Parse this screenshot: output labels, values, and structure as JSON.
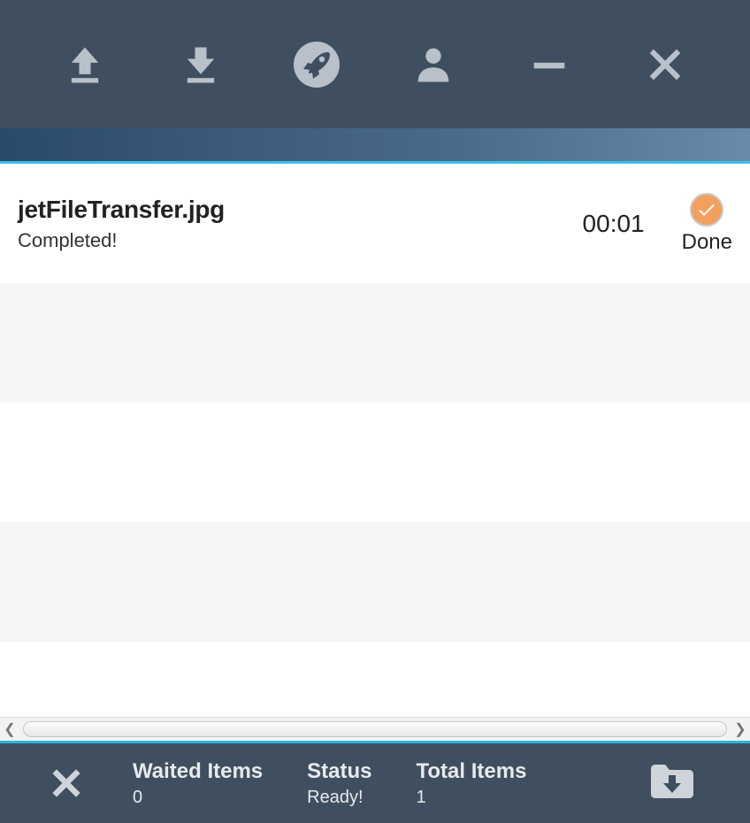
{
  "toolbar": {
    "icons": [
      "upload-icon",
      "download-icon",
      "rocket-icon",
      "user-icon",
      "minimize-icon",
      "close-icon"
    ]
  },
  "transfers": [
    {
      "filename": "jetFileTransfer.jpg",
      "status_text": "Completed!",
      "time": "00:01",
      "state_label": "Done"
    }
  ],
  "statusbar": {
    "waited_label": "Waited Items",
    "waited_value": "0",
    "status_label": "Status",
    "status_value": "Ready!",
    "total_label": "Total Items",
    "total_value": "1"
  }
}
